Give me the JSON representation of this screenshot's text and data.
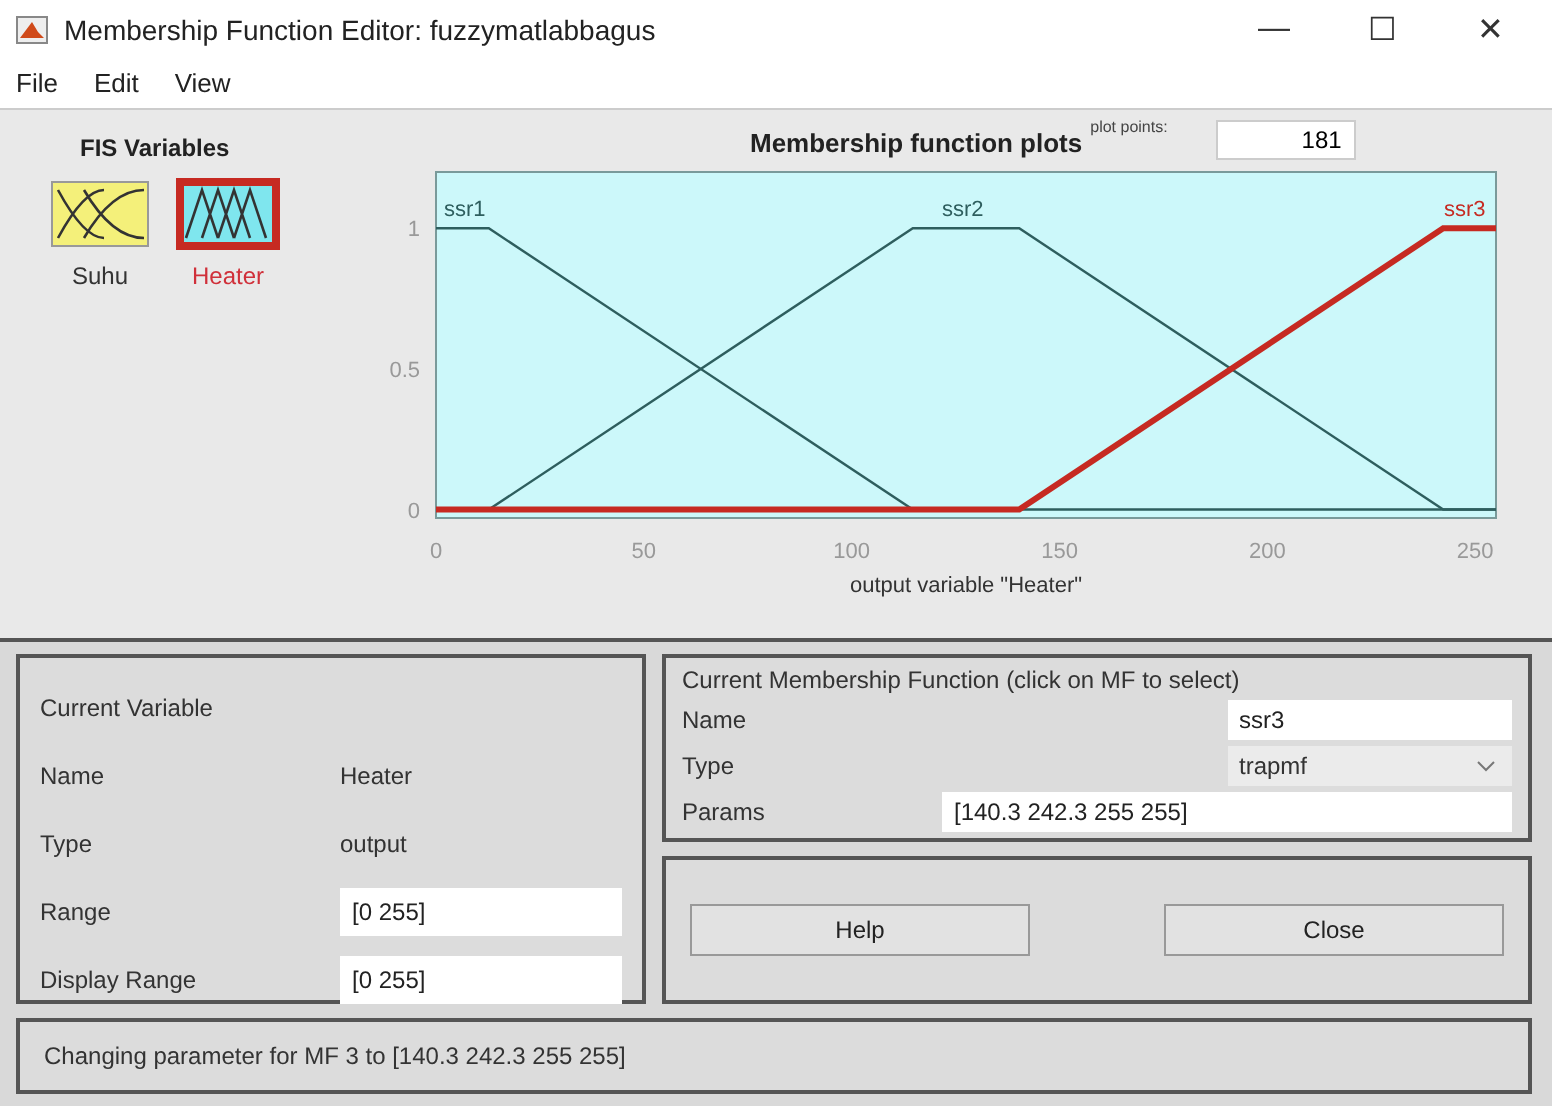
{
  "window": {
    "title": "Membership Function Editor: fuzzymatlabbagus",
    "controls": [
      "—",
      "☐",
      "✕"
    ]
  },
  "menu": [
    "File",
    "Edit",
    "View"
  ],
  "fis_variables": {
    "title": "FIS Variables",
    "items": [
      {
        "name": "Suhu",
        "kind": "input",
        "selected": false
      },
      {
        "name": "Heater",
        "kind": "output",
        "selected": true
      }
    ]
  },
  "plot": {
    "title": "Membership function plots",
    "points_label": "plot points:",
    "points_value": "181",
    "chart_data": {
      "type": "line",
      "xlabel": "output variable \"Heater\"",
      "x": [
        0,
        12.7,
        114.7,
        140.3,
        242.3,
        255
      ],
      "series": [
        {
          "name": "ssr1",
          "color": "#2e5e5e",
          "values": [
            1,
            1,
            0,
            0,
            0,
            0
          ]
        },
        {
          "name": "ssr2",
          "color": "#2e5e5e",
          "values": [
            null,
            0,
            1,
            1,
            0,
            0
          ]
        },
        {
          "name": "ssr3",
          "color": "#c62a22",
          "values": [
            0,
            0,
            0,
            0,
            1,
            1
          ]
        }
      ],
      "xlim": [
        0,
        255
      ],
      "ylim": [
        -0.03,
        1.2
      ],
      "xticks": [
        0,
        50,
        100,
        150,
        200,
        250
      ],
      "yticks": [
        0,
        0.5,
        1
      ]
    }
  },
  "current_variable": {
    "title": "Current Variable",
    "rows": [
      {
        "label": "Name",
        "value": "Heater",
        "kind": "text"
      },
      {
        "label": "Type",
        "value": "output",
        "kind": "text"
      },
      {
        "label": "Range",
        "value": "[0 255]",
        "kind": "field"
      },
      {
        "label": "Display Range",
        "value": "[0 255]",
        "kind": "field"
      }
    ]
  },
  "current_mf": {
    "title": "Current Membership Function (click on MF to select)",
    "name_label": "Name",
    "name_value": "ssr3",
    "type_label": "Type",
    "type_value": "trapmf",
    "params_label": "Params",
    "params_value": "[140.3 242.3 255 255]"
  },
  "buttons": [
    "Help",
    "Close"
  ],
  "status": "Changing parameter for MF 3 to  [140.3 242.3 255 255]"
}
